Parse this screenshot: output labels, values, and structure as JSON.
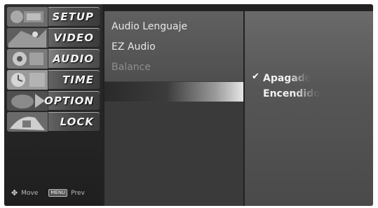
{
  "menu": {
    "items": [
      {
        "label": "SETUP",
        "icon": "setup-thumbnail-icon"
      },
      {
        "label": "VIDEO",
        "icon": "video-thumbnail-icon"
      },
      {
        "label": "AUDIO",
        "icon": "audio-thumbnail-icon"
      },
      {
        "label": "TIME",
        "icon": "time-thumbnail-icon"
      },
      {
        "label": "OPTION",
        "icon": "option-thumbnail-icon"
      },
      {
        "label": "LOCK",
        "icon": "lock-thumbnail-icon"
      }
    ],
    "active_index": 2,
    "footer": {
      "move_label": "Move",
      "prev_key": "MENU",
      "prev_label": "Prev"
    }
  },
  "submenu": {
    "items": [
      "Audio Lenguaje",
      "EZ Audio",
      "Balance"
    ],
    "selected_index": 2
  },
  "options": {
    "items": [
      "Apagado",
      "Encendido"
    ],
    "checked_index": 0,
    "check_glyph": "✔"
  },
  "colors": {
    "background": "#222222",
    "text": "#e8e8e8"
  }
}
